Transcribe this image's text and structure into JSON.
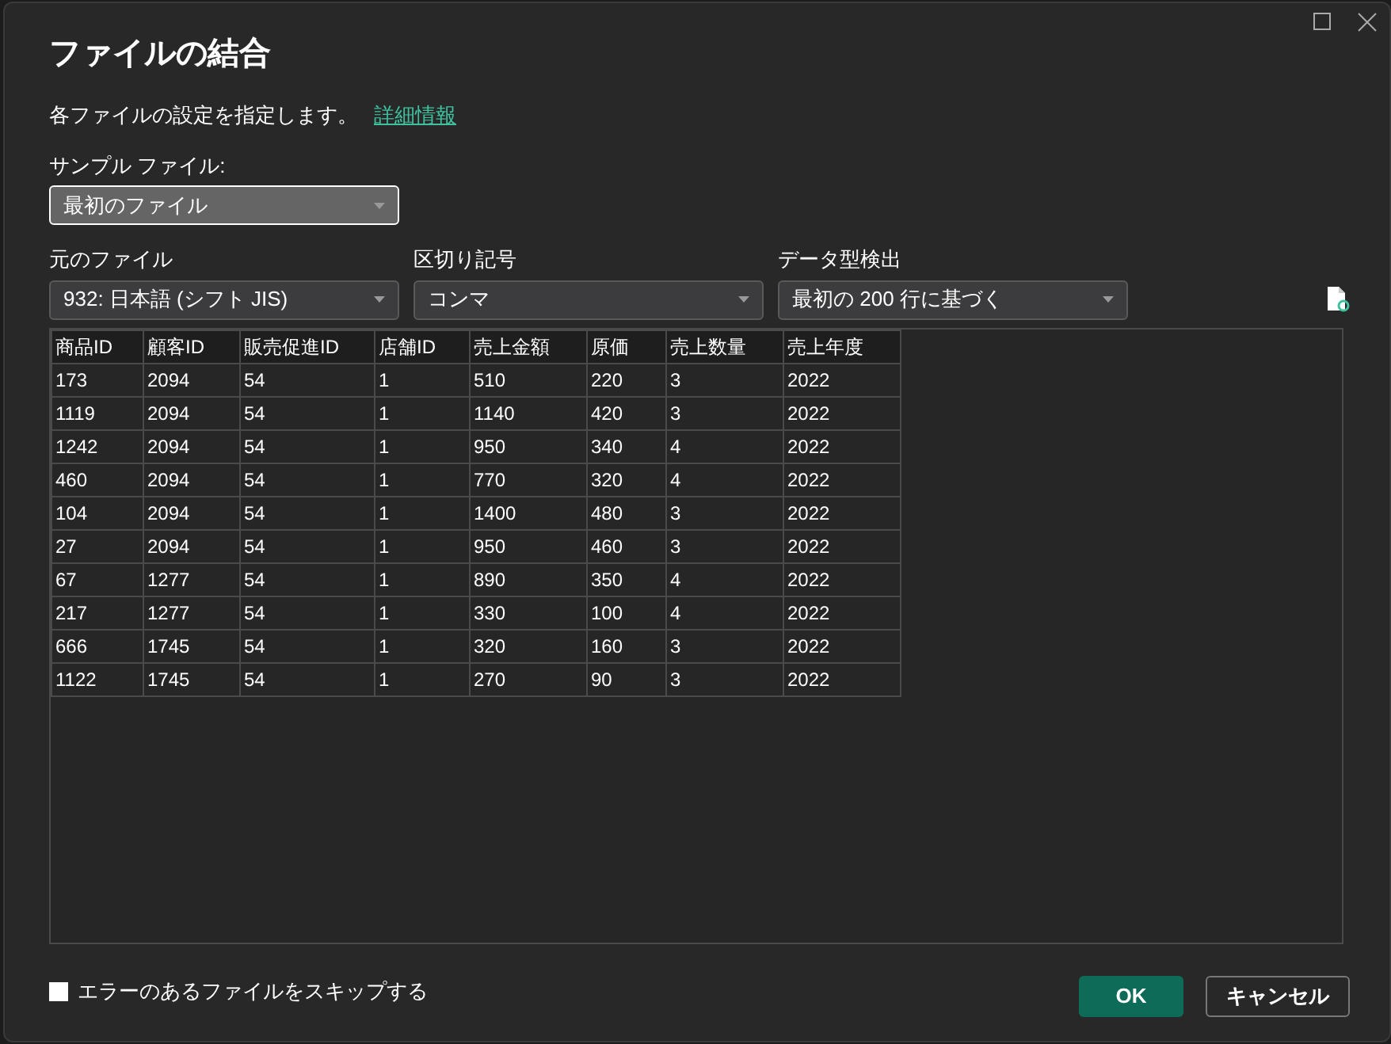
{
  "window": {
    "title": "ファイルの結合"
  },
  "description": {
    "text": "各ファイルの設定を指定します。",
    "link": "詳細情報"
  },
  "sample_file": {
    "label": "サンプル ファイル:",
    "value": "最初のファイル"
  },
  "options": [
    {
      "label": "元のファイル",
      "value": "932: 日本語 (シフト JIS)"
    },
    {
      "label": "区切り記号",
      "value": "コンマ"
    },
    {
      "label": "データ型検出",
      "value": "最初の 200 行に基づく"
    }
  ],
  "table": {
    "columns": [
      "商品ID",
      "顧客ID",
      "販売促進ID",
      "店舗ID",
      "売上金額",
      "原価",
      "売上数量",
      "売上年度"
    ],
    "rows": [
      [
        "173",
        "2094",
        "54",
        "1",
        "510",
        "220",
        "3",
        "2022"
      ],
      [
        "1119",
        "2094",
        "54",
        "1",
        "1140",
        "420",
        "3",
        "2022"
      ],
      [
        "1242",
        "2094",
        "54",
        "1",
        "950",
        "340",
        "4",
        "2022"
      ],
      [
        "460",
        "2094",
        "54",
        "1",
        "770",
        "320",
        "4",
        "2022"
      ],
      [
        "104",
        "2094",
        "54",
        "1",
        "1400",
        "480",
        "3",
        "2022"
      ],
      [
        "27",
        "2094",
        "54",
        "1",
        "950",
        "460",
        "3",
        "2022"
      ],
      [
        "67",
        "1277",
        "54",
        "1",
        "890",
        "350",
        "4",
        "2022"
      ],
      [
        "217",
        "1277",
        "54",
        "1",
        "330",
        "100",
        "4",
        "2022"
      ],
      [
        "666",
        "1745",
        "54",
        "1",
        "320",
        "160",
        "3",
        "2022"
      ],
      [
        "1122",
        "1745",
        "54",
        "1",
        "270",
        "90",
        "3",
        "2022"
      ]
    ]
  },
  "skip_errors": {
    "label": "エラーのあるファイルをスキップする",
    "checked": false
  },
  "buttons": [
    {
      "label": "OK",
      "kind": "primary"
    },
    {
      "label": "キャンセル",
      "kind": "secondary"
    }
  ]
}
